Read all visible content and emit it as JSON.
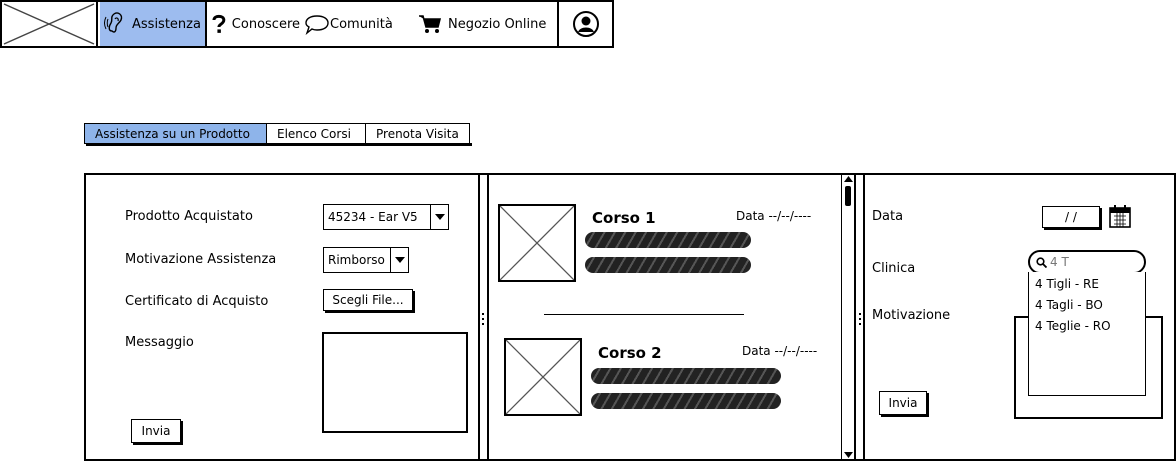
{
  "nav": {
    "items": [
      {
        "label": "Assistenza",
        "icon": "ear-icon",
        "active": true
      },
      {
        "label": "Conoscere",
        "icon": "question-icon"
      },
      {
        "label": "Comunità",
        "icon": "speech-bubble-icon"
      },
      {
        "label": "Negozio Online",
        "icon": "cart-icon"
      }
    ],
    "profile_icon": "user-icon",
    "accent": "#9dbcef"
  },
  "tabs": [
    {
      "label": "Assistenza su un Prodotto",
      "active": true
    },
    {
      "label": "Elenco Corsi"
    },
    {
      "label": "Prenota Visita"
    }
  ],
  "assist_form": {
    "product_label": "Prodotto Acquistato",
    "product_value": "45234 - Ear V5",
    "reason_label": "Motivazione Assistenza",
    "reason_value": "Rimborso",
    "certificate_label": "Certificato di Acquisto",
    "certificate_button": "Scegli File...",
    "message_label": "Messaggio",
    "submit": "Invia"
  },
  "courses": [
    {
      "title": "Corso 1",
      "date": "Data --/--/----"
    },
    {
      "title": "Corso 2",
      "date": "Data --/--/----"
    }
  ],
  "booking": {
    "date_label": "Data",
    "date_value": "/ /",
    "clinic_label": "Clinica",
    "clinic_search": "4 T",
    "clinic_options": [
      "4 Tigli - RE",
      "4 Tagli - BO",
      "4 Teglie - RO"
    ],
    "reason_label": "Motivazione",
    "submit": "Invia"
  }
}
